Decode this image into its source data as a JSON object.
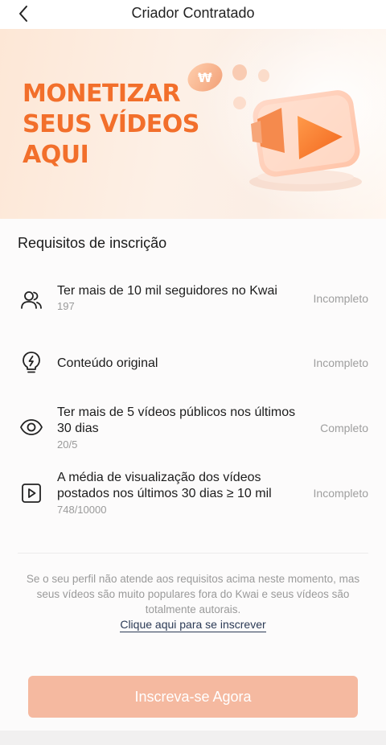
{
  "header": {
    "title": "Criador Contratado",
    "back_icon": "chevron-left-icon"
  },
  "banner": {
    "line1": "MONETIZAR",
    "line2": "SEUS VÍDEOS",
    "line3": "AQUI"
  },
  "requirements": {
    "title": "Requisitos de inscrição",
    "items": [
      {
        "icon": "users-icon",
        "title": "Ter mais de 10 mil seguidores no Kwai",
        "subtitle": "197",
        "status": "Incompleto"
      },
      {
        "icon": "lightbulb-icon",
        "title": "Conteúdo original",
        "subtitle": "",
        "status": "Incompleto"
      },
      {
        "icon": "eye-icon",
        "title": "Ter mais de 5 vídeos públicos nos últimos 30 dias",
        "subtitle": "20/5",
        "status": "Completo"
      },
      {
        "icon": "play-square-icon",
        "title": "A média de visualização dos vídeos postados nos últimos 30 dias ≥ 10 mil",
        "subtitle": "748/10000",
        "status": "Incompleto"
      }
    ]
  },
  "note": "Se o seu perfil não atende aos requisitos acima neste momento, mas seus vídeos são muito populares fora do Kwai e seus vídeos são totalmente autorais.",
  "signup_link": "Clique aqui para se inscrever",
  "cta": "Inscreva-se Agora",
  "colors": {
    "brand": "#f26f2b",
    "cta": "#f5b9a0"
  }
}
